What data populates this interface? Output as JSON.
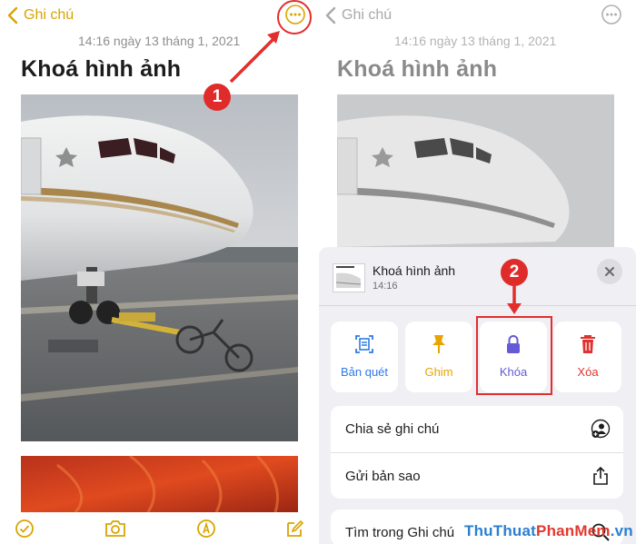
{
  "left_screen": {
    "back_label": "Ghi chú",
    "timestamp": "14:16 ngày 13 tháng 1, 2021",
    "note_title": "Khoá hình ảnh",
    "toolbar_icons": [
      "checklist-icon",
      "camera-icon",
      "markup-pen-icon",
      "compose-icon"
    ]
  },
  "right_screen": {
    "back_label": "Ghi chú",
    "timestamp": "14:16 ngày 13 tháng 1, 2021",
    "note_title": "Khoá hình ảnh",
    "sheet": {
      "title": "Khoá hình ảnh",
      "time": "14:16",
      "actions": [
        {
          "label": "Bản quét",
          "icon": "scan-icon",
          "color": "#2f7ae5"
        },
        {
          "label": "Ghim",
          "icon": "pin-icon",
          "color": "#e9a400"
        },
        {
          "label": "Khóa",
          "icon": "lock-icon",
          "color": "#6459d6"
        },
        {
          "label": "Xóa",
          "icon": "trash-icon",
          "color": "#e0332f"
        }
      ],
      "rows": [
        {
          "label": "Chia sẻ ghi chú",
          "icon": "person-add-icon"
        },
        {
          "label": "Gửi bản sao",
          "icon": "share-icon"
        },
        {
          "label": "Tìm trong Ghi chú",
          "icon": "search-icon"
        }
      ]
    }
  },
  "annotations": {
    "step_1": "1",
    "step_2": "2",
    "highlight_color": "#e32e2e"
  },
  "watermark": {
    "part1": "ThuThuat",
    "part2": "PhanMem",
    "part3": ".vn",
    "color1": "#2a7fd3",
    "color2": "#e3382d"
  }
}
